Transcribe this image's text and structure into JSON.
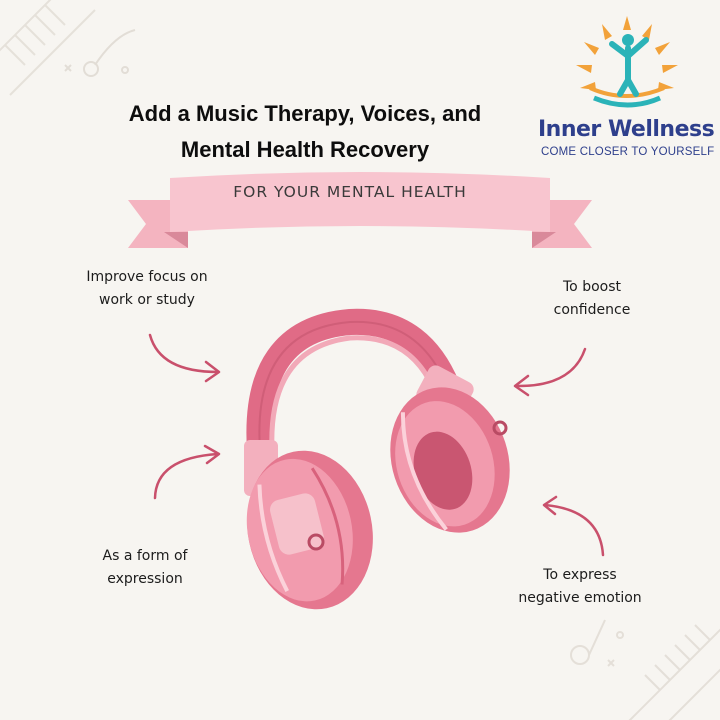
{
  "title": {
    "line1": "Add a Music Therapy, Voices, and",
    "line2": "Mental Health Recovery"
  },
  "logo": {
    "name": "Inner Wellness",
    "tagline": "COME CLOSER TO YOURSELF"
  },
  "banner": {
    "text": "FOR YOUR MENTAL HEALTH"
  },
  "benefits": {
    "focus": {
      "line1": "Improve focus on",
      "line2": "work or study"
    },
    "confidence": {
      "line1": "To boost",
      "line2": "confidence"
    },
    "expression": {
      "line1": "As a form of",
      "line2": "expression"
    },
    "negative": {
      "line1": "To express",
      "line2": "negative emotion"
    }
  },
  "colors": {
    "background": "#f7f5f1",
    "accent_pink": "#e8899c",
    "arrow": "#c9506c",
    "logo_blue": "#2e3f8c",
    "sun_orange": "#f2a23a",
    "figure_teal": "#2bb3b8"
  },
  "icons": [
    "piano-keys-icon",
    "music-note-icon",
    "sun-logo-icon",
    "headphones-icon",
    "arrow-icon"
  ]
}
